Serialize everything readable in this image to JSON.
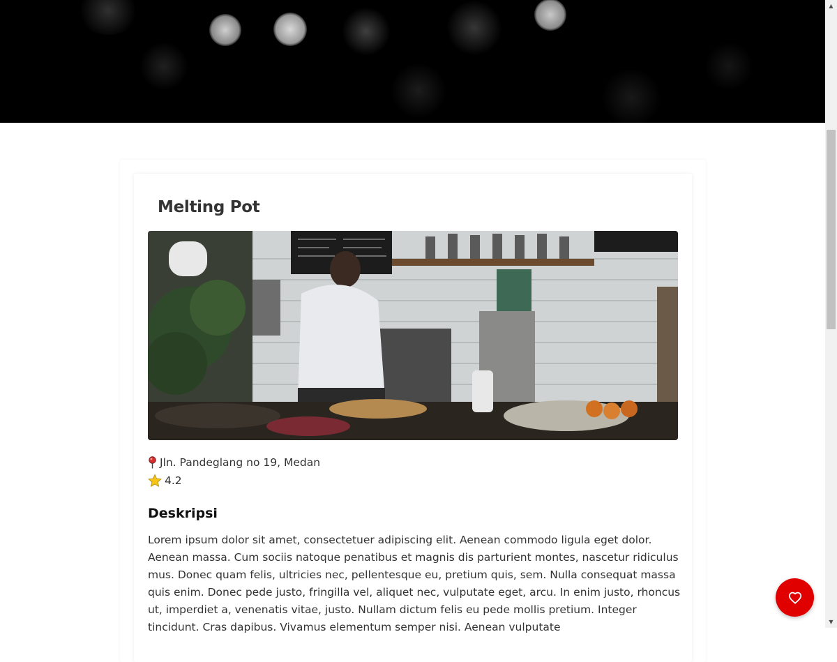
{
  "restaurant": {
    "name": "Melting Pot",
    "image_alt": "Cafe interior with a barista behind the counter",
    "address": "Jln. Pandeglang no 19, Medan",
    "rating": "4.2"
  },
  "description": {
    "heading": "Deskripsi",
    "text": "Lorem ipsum dolor sit amet, consectetuer adipiscing elit. Aenean commodo ligula eget dolor. Aenean massa. Cum sociis natoque penatibus et magnis dis parturient montes, nascetur ridiculus mus. Donec quam felis, ultricies nec, pellentesque eu, pretium quis, sem. Nulla consequat massa quis enim. Donec pede justo, fringilla vel, aliquet nec, vulputate eget, arcu. In enim justo, rhoncus ut, imperdiet a, venenatis vitae, justo. Nullam dictum felis eu pede mollis pretium. Integer tincidunt. Cras dapibus. Vivamus elementum semper nisi. Aenean vulputate"
  },
  "favorite_button": {
    "aria_label": "Like this restaurant",
    "color": "#e00000",
    "icon": "heart-outline-icon"
  },
  "icons": {
    "address": "pin-icon",
    "rating": "star-icon"
  }
}
